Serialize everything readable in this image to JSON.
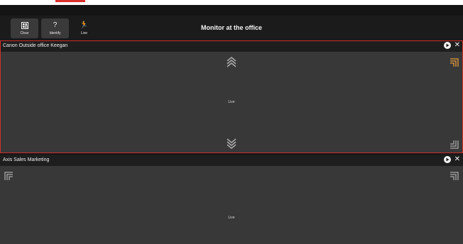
{
  "toolbar": {
    "clear_label": "Clear",
    "identify_label": "Identify",
    "live_label": "Live",
    "identify_icon": "?",
    "live_icon": "🏃"
  },
  "page": {
    "title": "Monitor at the office"
  },
  "panels": [
    {
      "name": "Canon Outside office Keegan",
      "status": "Live"
    },
    {
      "name": "Axis Sales Marketing",
      "status": "Live"
    }
  ],
  "colors": {
    "accent": "#d2302b",
    "ptz_active": "#e39a3a",
    "ptz_inactive": "#a8a8a8"
  }
}
